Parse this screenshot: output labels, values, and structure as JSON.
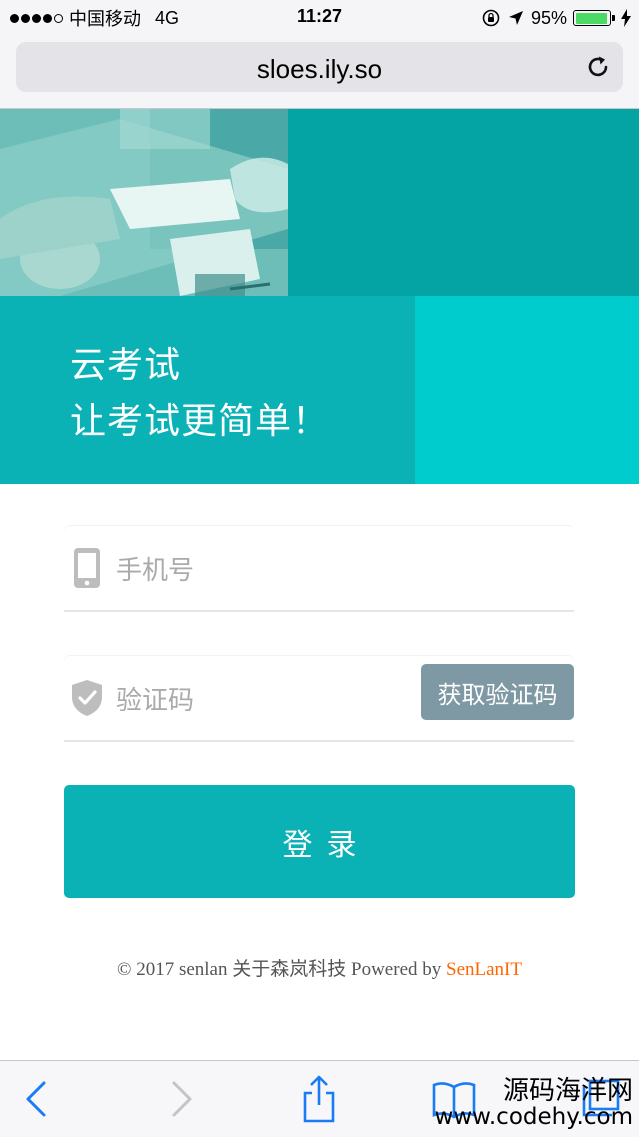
{
  "status_bar": {
    "carrier": "中国移动",
    "network": "4G",
    "time": "11:27",
    "battery": "95%",
    "battery_level": 0.95,
    "battery_color": "#4cd964"
  },
  "browser": {
    "url": "sloes.ily.so",
    "reload_icon": "reload-icon"
  },
  "hero": {
    "line1": "云考试",
    "line2": "让考试更简单！",
    "colors": {
      "dark_teal": "#03a4a3",
      "teal": "#0ab2b5",
      "cyan": "#00cccd"
    }
  },
  "form": {
    "phone_placeholder": "手机号",
    "phone_icon": "mobile-phone-icon",
    "code_placeholder": "验证码",
    "code_icon": "shield-check-icon",
    "get_code_label": "获取验证码",
    "login_label": "登录"
  },
  "footer": {
    "copyright": "© 2017 senlan",
    "about": "关于森岚科技",
    "powered_by": "Powered by",
    "brand": "SenLanIT",
    "brand_color": "#ff6600"
  },
  "toolbar": {
    "icons": [
      "back-icon",
      "forward-icon",
      "share-icon",
      "bookmarks-icon",
      "tabs-icon"
    ]
  },
  "watermark": {
    "line1": "源码海洋网",
    "line2": "www.codehy.com"
  }
}
